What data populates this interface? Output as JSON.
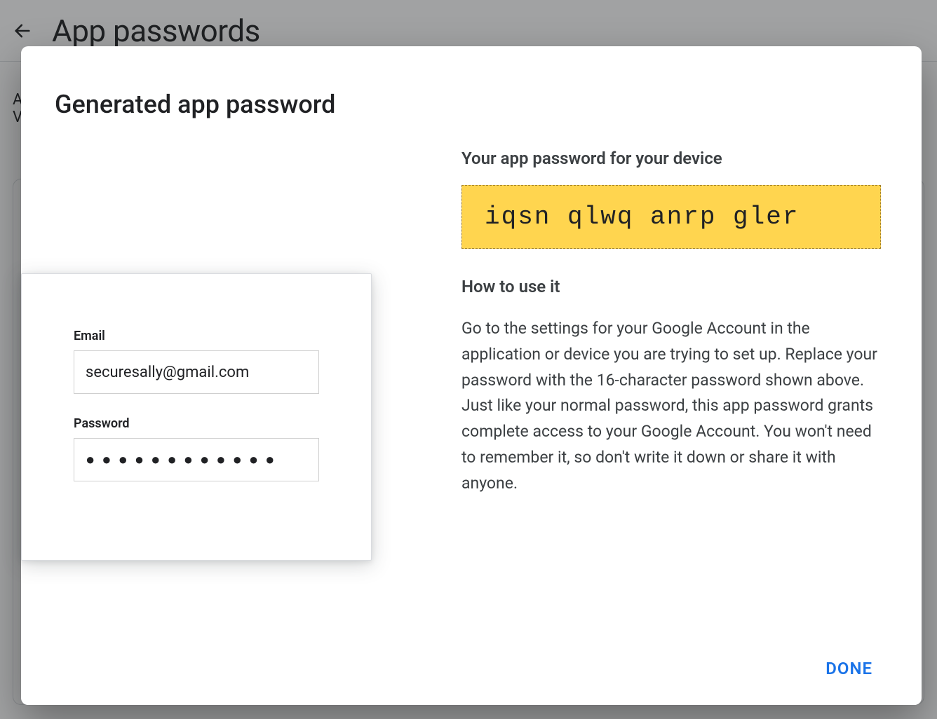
{
  "backdrop": {
    "title": "App passwords",
    "body_line1": "A",
    "body_line2": "V"
  },
  "modal": {
    "title": "Generated app password",
    "login_card": {
      "email_label": "Email",
      "email_value": "securesally@gmail.com",
      "password_label": "Password",
      "password_dots": "●●●●●●●●●●●●"
    },
    "right": {
      "subhead": "Your app password for your device",
      "generated_password": "iqsn qlwq anrp gler",
      "howto_head": "How to use it",
      "howto_body": "Go to the settings for your Google Account in the application or device you are trying to set up. Replace your password with the 16-character password shown above.\nJust like your normal password, this app password grants complete access to your Google Account. You won't need to remember it, so don't write it down or share it with anyone."
    },
    "done_label": "DONE"
  }
}
